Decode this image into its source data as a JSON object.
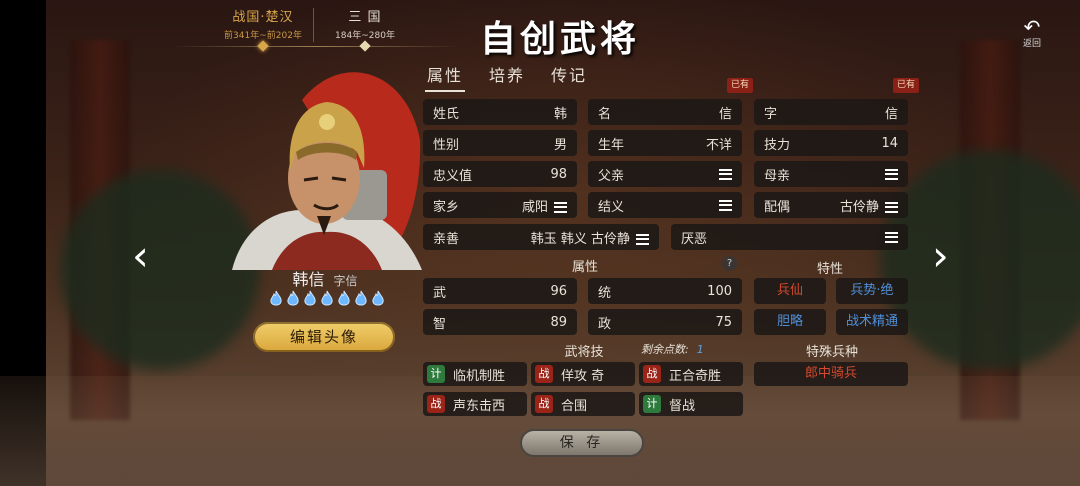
{
  "header": {
    "title": "自创武将",
    "back_label": "返回",
    "eras": [
      {
        "name": "战国·楚汉",
        "years": "前341年~前202年",
        "active": true
      },
      {
        "name": "三 国",
        "years": "184年~280年",
        "active": false
      }
    ]
  },
  "character": {
    "full_name": "韩信",
    "style_name": "字信",
    "edit_avatar_label": "编辑头像",
    "flame_count": 7
  },
  "tabs": [
    "属性",
    "培养",
    "传记"
  ],
  "owned_tag": "已有",
  "info": {
    "surname_label": "姓氏",
    "surname": "韩",
    "given_label": "名",
    "given": "信",
    "courtesy_label": "字",
    "courtesy": "信",
    "gender_label": "性别",
    "gender": "男",
    "birth_label": "生年",
    "birth": "不详",
    "skill_power_label": "技力",
    "skill_power": "14",
    "loyalty_label": "忠义值",
    "loyalty": "98",
    "father_label": "父亲",
    "mother_label": "母亲",
    "hometown_label": "家乡",
    "hometown": "咸阳",
    "sworn_label": "结义",
    "spouse_label": "配偶",
    "spouse": "古伶静",
    "friendly_label": "亲善",
    "friendly": "韩玉 韩义 古伶静",
    "dislike_label": "厌恶"
  },
  "attributes": {
    "heading": "属性",
    "help": "?",
    "wu_label": "武",
    "wu": "96",
    "tong_label": "统",
    "tong": "100",
    "zhi_label": "智",
    "zhi": "89",
    "zheng_label": "政",
    "zheng": "75"
  },
  "traits": {
    "heading": "特性",
    "items": [
      {
        "label": "兵仙",
        "color": "#d44a2e"
      },
      {
        "label": "兵势·绝",
        "color": "#4f8fd8"
      },
      {
        "label": "胆略",
        "color": "#4f8fd8"
      },
      {
        "label": "战术精通",
        "color": "#4f8fd8"
      }
    ]
  },
  "skills": {
    "heading": "武将技",
    "remaining_label": "剩余点数:",
    "remaining": "1",
    "items": [
      {
        "type": "计",
        "name": "临机制胜"
      },
      {
        "type": "战",
        "name": "佯攻 奇"
      },
      {
        "type": "战",
        "name": "正合奇胜"
      },
      {
        "type": "战",
        "name": "声东击西"
      },
      {
        "type": "战",
        "name": "合围"
      },
      {
        "type": "计",
        "name": "督战"
      }
    ]
  },
  "special_troop": {
    "heading": "特殊兵种",
    "value": "郎中骑兵"
  },
  "save_label": "保 存",
  "colors": {
    "accent_gold": "#d8a64a",
    "trait_red": "#d44a2e",
    "trait_blue": "#4f8fd8",
    "ji_green": "#2e7a3c",
    "zhan_red": "#9a2418"
  }
}
